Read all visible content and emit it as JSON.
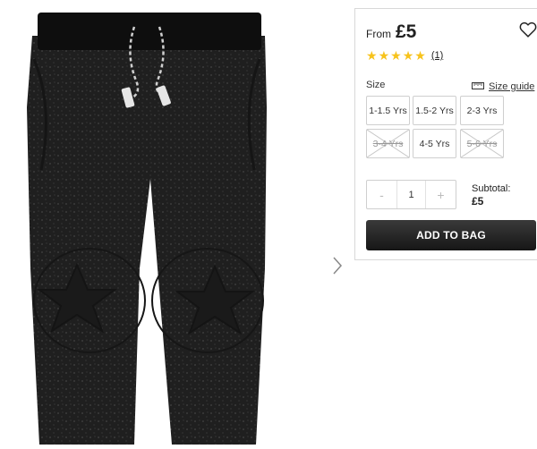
{
  "product": {
    "price_prefix": "From",
    "price": "£5",
    "rating": 5,
    "review_count": "(1)"
  },
  "sizes": {
    "label": "Size",
    "guide_label": "Size guide",
    "options": [
      {
        "label": "1-1.5 Yrs",
        "available": true
      },
      {
        "label": "1.5-2 Yrs",
        "available": true
      },
      {
        "label": "2-3 Yrs",
        "available": true
      },
      {
        "label": "3-4 Yrs",
        "available": false
      },
      {
        "label": "4-5 Yrs",
        "available": true
      },
      {
        "label": "5-6 Yrs",
        "available": false
      }
    ]
  },
  "quantity": {
    "minus": "-",
    "value": "1",
    "plus": "+"
  },
  "subtotal": {
    "label": "Subtotal:",
    "amount": "£5"
  },
  "cta": {
    "add_to_bag": "ADD TO BAG"
  },
  "colors": {
    "star": "#f7c31c",
    "button": "#1e1e1e"
  }
}
